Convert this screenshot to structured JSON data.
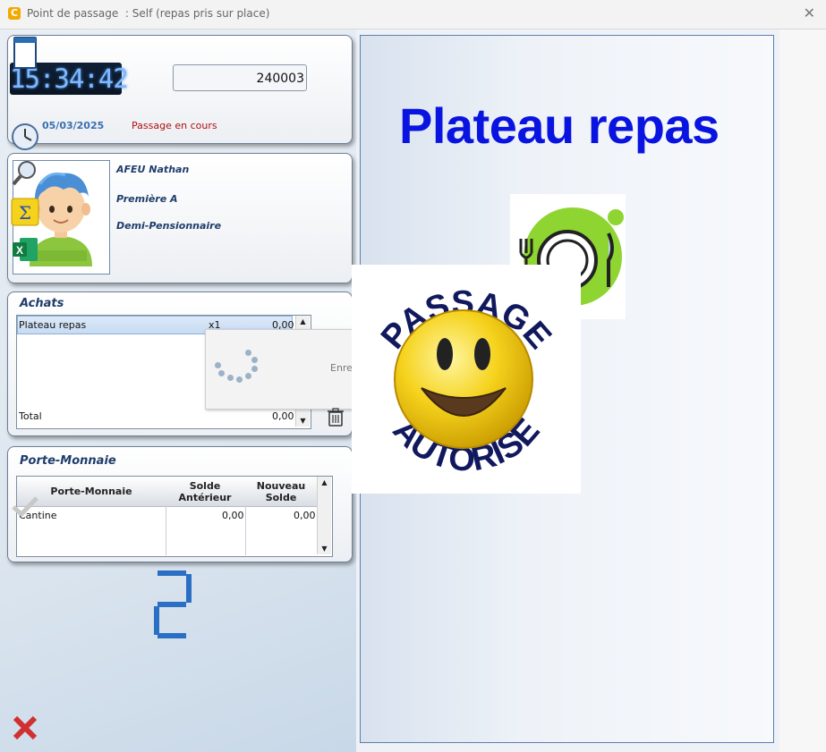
{
  "window": {
    "title": "Point de passage  : Self (repas pris sur place)",
    "app_logo": "C"
  },
  "clock": {
    "time": "15:34:42"
  },
  "badge_input": {
    "value": "240003"
  },
  "status": {
    "date": "05/03/2025",
    "passage": "Passage en cours"
  },
  "student": {
    "name": "AFEU Nathan",
    "class": "Première A",
    "regime": "Demi-Pensionnaire"
  },
  "achats": {
    "title": "Achats",
    "rows": [
      {
        "label": "Plateau repas",
        "qty": "x1",
        "amount": "0,00"
      }
    ],
    "total_label": "Total",
    "total_value": "0,00",
    "loading_text": "Enre"
  },
  "porte_monnaie": {
    "title": "Porte-Monnaie",
    "col_name": "Porte-Monnaie",
    "col_prev_1": "Solde",
    "col_prev_2": "Antérieur",
    "col_new_1": "Nouveau",
    "col_new_2": "Solde",
    "rows": [
      {
        "name": "Cantine",
        "previous": "0,00",
        "new": "0,00"
      }
    ]
  },
  "counter": {
    "value": 2
  },
  "main": {
    "title": "Plateau repas"
  },
  "stamp": {
    "top_text": "PASSAGE",
    "bottom_text": "AUTORISE"
  },
  "toolbar_icons": [
    "calculator-icon",
    "clock-icon",
    "search-icon",
    "sigma-icon",
    "excel-icon",
    "checkmark-icon",
    "close-icon"
  ],
  "colors": {
    "accent_blue": "#0a14e0",
    "status_red": "#b01010",
    "label_blue": "#1f3d6b"
  }
}
